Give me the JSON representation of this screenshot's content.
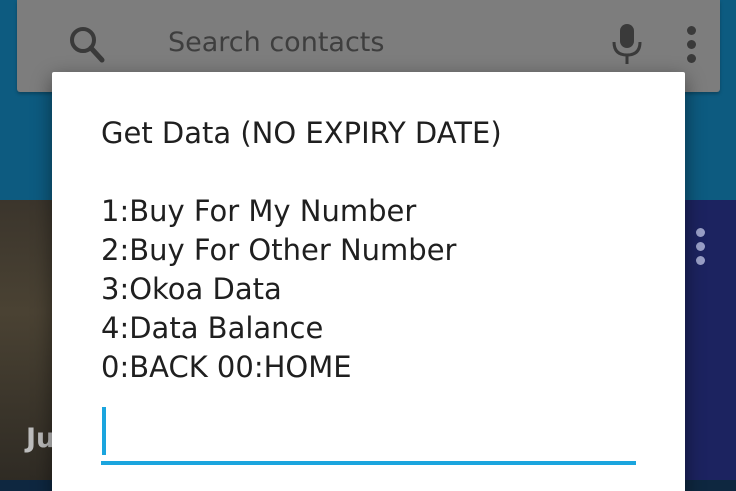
{
  "search": {
    "placeholder": "Search contacts"
  },
  "background": {
    "card_initials": "Ju"
  },
  "dialog": {
    "title": "Get Data (NO EXPIRY DATE)",
    "options": [
      "1:Buy For My Number",
      "2:Buy For Other Number",
      "3:Okoa Data",
      "4:Data Balance",
      "0:BACK 00:HOME"
    ],
    "reply_value": ""
  },
  "colors": {
    "accent": "#1ba5de",
    "dialog_background": "#ffffff",
    "dialog_text": "#1f1f1f",
    "app_header": "#0d5b80"
  },
  "icons": {
    "search": "search-icon",
    "mic": "microphone-icon",
    "menu": "more-vert-icon"
  }
}
